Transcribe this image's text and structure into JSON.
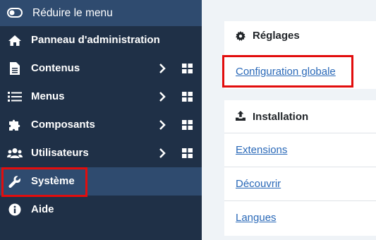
{
  "sidebar": {
    "toggle_label": "Réduire le menu",
    "items": [
      {
        "label": "Panneau d'administration",
        "icon": "home-icon"
      },
      {
        "label": "Contenus",
        "icon": "file-icon"
      },
      {
        "label": "Menus",
        "icon": "list-icon"
      },
      {
        "label": "Composants",
        "icon": "puzzle-icon"
      },
      {
        "label": "Utilisateurs",
        "icon": "users-icon"
      },
      {
        "label": "Système",
        "icon": "wrench-icon"
      },
      {
        "label": "Aide",
        "icon": "info-icon"
      }
    ]
  },
  "main": {
    "settings": {
      "title": "Réglages",
      "icon": "gear-icon",
      "links": [
        "Configuration globale"
      ]
    },
    "install": {
      "title": "Installation",
      "icon": "upload-icon",
      "links": [
        "Extensions",
        "Découvrir",
        "Langues"
      ]
    }
  },
  "colors": {
    "sidebar_bg": "#1f3047",
    "sidebar_active": "#2f4b6f",
    "highlight": "#e20d0d",
    "link": "#2a69b8"
  }
}
